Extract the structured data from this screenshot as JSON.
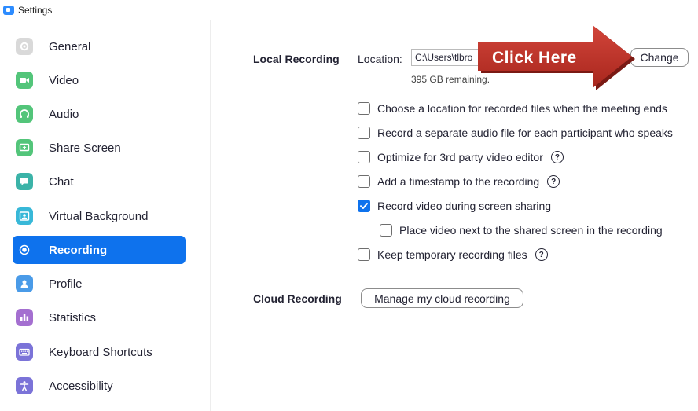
{
  "window": {
    "title": "Settings"
  },
  "sidebar": {
    "items": [
      {
        "label": "General",
        "icon": "gear-icon",
        "color": "#d4d4d4"
      },
      {
        "label": "Video",
        "icon": "video-camera-icon",
        "color": "#53c57a"
      },
      {
        "label": "Audio",
        "icon": "headphones-icon",
        "color": "#53c57a"
      },
      {
        "label": "Share Screen",
        "icon": "share-screen-icon",
        "color": "#53c57a"
      },
      {
        "label": "Chat",
        "icon": "chat-bubble-icon",
        "color": "#3bb3a8"
      },
      {
        "label": "Virtual Background",
        "icon": "person-frame-icon",
        "color": "#38b8d8"
      },
      {
        "label": "Recording",
        "icon": "record-icon",
        "color": "#0e72ed",
        "active": true
      },
      {
        "label": "Profile",
        "icon": "profile-icon",
        "color": "#4a9be8"
      },
      {
        "label": "Statistics",
        "icon": "bar-chart-icon",
        "color": "#a46fd0"
      },
      {
        "label": "Keyboard Shortcuts",
        "icon": "keyboard-icon",
        "color": "#7b73d8"
      },
      {
        "label": "Accessibility",
        "icon": "accessibility-icon",
        "color": "#7b73d8"
      }
    ]
  },
  "local_recording": {
    "section_label": "Local Recording",
    "location_label": "Location:",
    "path_value": "C:\\Users\\tlbro",
    "remaining_text": "395 GB remaining.",
    "change_button": "Change",
    "options": [
      {
        "label": "Choose a location for recorded files when the meeting ends",
        "checked": false,
        "help": false
      },
      {
        "label": "Record a separate audio file for each participant who speaks",
        "checked": false,
        "help": false
      },
      {
        "label": "Optimize for 3rd party video editor",
        "checked": false,
        "help": true
      },
      {
        "label": "Add a timestamp to the recording",
        "checked": false,
        "help": true
      },
      {
        "label": "Record video during screen sharing",
        "checked": true,
        "help": false
      },
      {
        "label": "Place video next to the shared screen in the recording",
        "checked": false,
        "help": false,
        "indent": true
      },
      {
        "label": "Keep temporary recording files",
        "checked": false,
        "help": true
      }
    ]
  },
  "cloud_recording": {
    "section_label": "Cloud Recording",
    "manage_button": "Manage my cloud recording"
  },
  "annotation": {
    "arrow_text": "Click Here",
    "arrow_color": "#c0392b"
  },
  "help_symbol": "?"
}
